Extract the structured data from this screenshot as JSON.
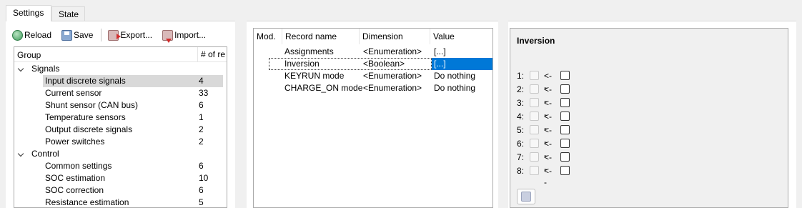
{
  "tabs": [
    {
      "label": "Settings",
      "active": true
    },
    {
      "label": "State",
      "active": false
    }
  ],
  "toolbar": {
    "reload_label": "Reload",
    "save_label": "Save",
    "export_label": "Export...",
    "import_label": "Import..."
  },
  "tree": {
    "col_group": "Group",
    "col_count": "# of re",
    "groups": [
      {
        "label": "Signals",
        "items": [
          {
            "label": "Input discrete signals",
            "count": "4"
          },
          {
            "label": "Current sensor",
            "count": "33"
          },
          {
            "label": "Shunt sensor (CAN bus)",
            "count": "6"
          },
          {
            "label": "Temperature sensors",
            "count": "1"
          },
          {
            "label": "Output discrete signals",
            "count": "2"
          },
          {
            "label": "Power switches",
            "count": "2"
          }
        ]
      },
      {
        "label": "Control",
        "items": [
          {
            "label": "Common settings",
            "count": "6"
          },
          {
            "label": "SOC estimation",
            "count": "10"
          },
          {
            "label": "SOC correction",
            "count": "6"
          },
          {
            "label": "Resistance estimation",
            "count": "5"
          }
        ]
      }
    ]
  },
  "records": {
    "col_mod": "Mod.",
    "col_name": "Record name",
    "col_dim": "Dimension",
    "col_val": "Value",
    "rows": [
      {
        "name": "Assignments",
        "dim": "<Enumeration>",
        "val": "[...]"
      },
      {
        "name": "Inversion",
        "dim": "<Boolean>",
        "val": "[...]"
      },
      {
        "name": "KEYRUN mode",
        "dim": "<Enumeration>",
        "val": "Do nothing"
      },
      {
        "name": "CHARGE_ON mode",
        "dim": "<Enumeration>",
        "val": "Do nothing"
      }
    ]
  },
  "detail": {
    "title": "Inversion",
    "bits": [
      {
        "label": "1:",
        "arrow": "<--"
      },
      {
        "label": "2:",
        "arrow": "<--"
      },
      {
        "label": "3:",
        "arrow": "<--"
      },
      {
        "label": "4:",
        "arrow": "<--"
      },
      {
        "label": "5:",
        "arrow": "<--"
      },
      {
        "label": "6:",
        "arrow": "<--"
      },
      {
        "label": "7:",
        "arrow": "<--"
      },
      {
        "label": "8:",
        "arrow": "<--"
      }
    ]
  },
  "colors": {
    "selection": "#0078d7",
    "tree_selection": "#d9d9d9"
  }
}
